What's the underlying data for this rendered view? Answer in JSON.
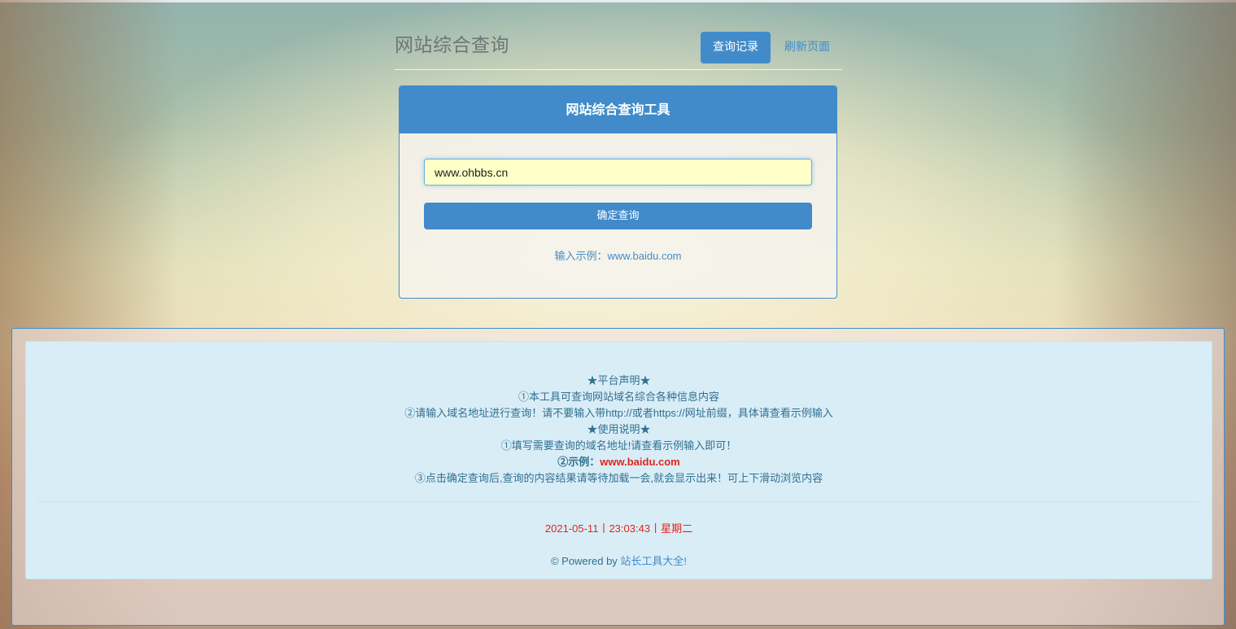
{
  "header": {
    "title": "网站综合查询",
    "history_button": "查询记录",
    "refresh_link": "刷新页面"
  },
  "panel": {
    "heading": "网站综合查询工具",
    "input_value": "www.ohbbs.cn",
    "submit_label": "确定查询",
    "example_hint": "输入示例：www.baidu.com"
  },
  "footer": {
    "notice_lines": [
      "★平台声明★",
      "①本工具可查询网站域名综合各种信息内容",
      "②请输入域名地址进行查询！请不要输入带http://或者https://网址前缀，具体请查看示例输入",
      "★使用说明★",
      "①填写需要查询的域名地址!请查看示例输入即可！"
    ],
    "example_prefix": "②示例：",
    "example_domain": "www.baidu.com",
    "notice_last": "③点击确定查询后,查询的内容结果请等待加载一会,就会显示出来！可上下滑动浏览内容",
    "date": "2021-05-11",
    "time": "23:03:43",
    "weekday": "星期二",
    "separator": "丨",
    "powered_prefix": "© Powered by ",
    "powered_link": "站长工具大全!"
  },
  "colors": {
    "primary": "#428bca",
    "accent_red": "#e0251b",
    "info_text": "#31708f",
    "info_bg": "#d9edf7"
  }
}
